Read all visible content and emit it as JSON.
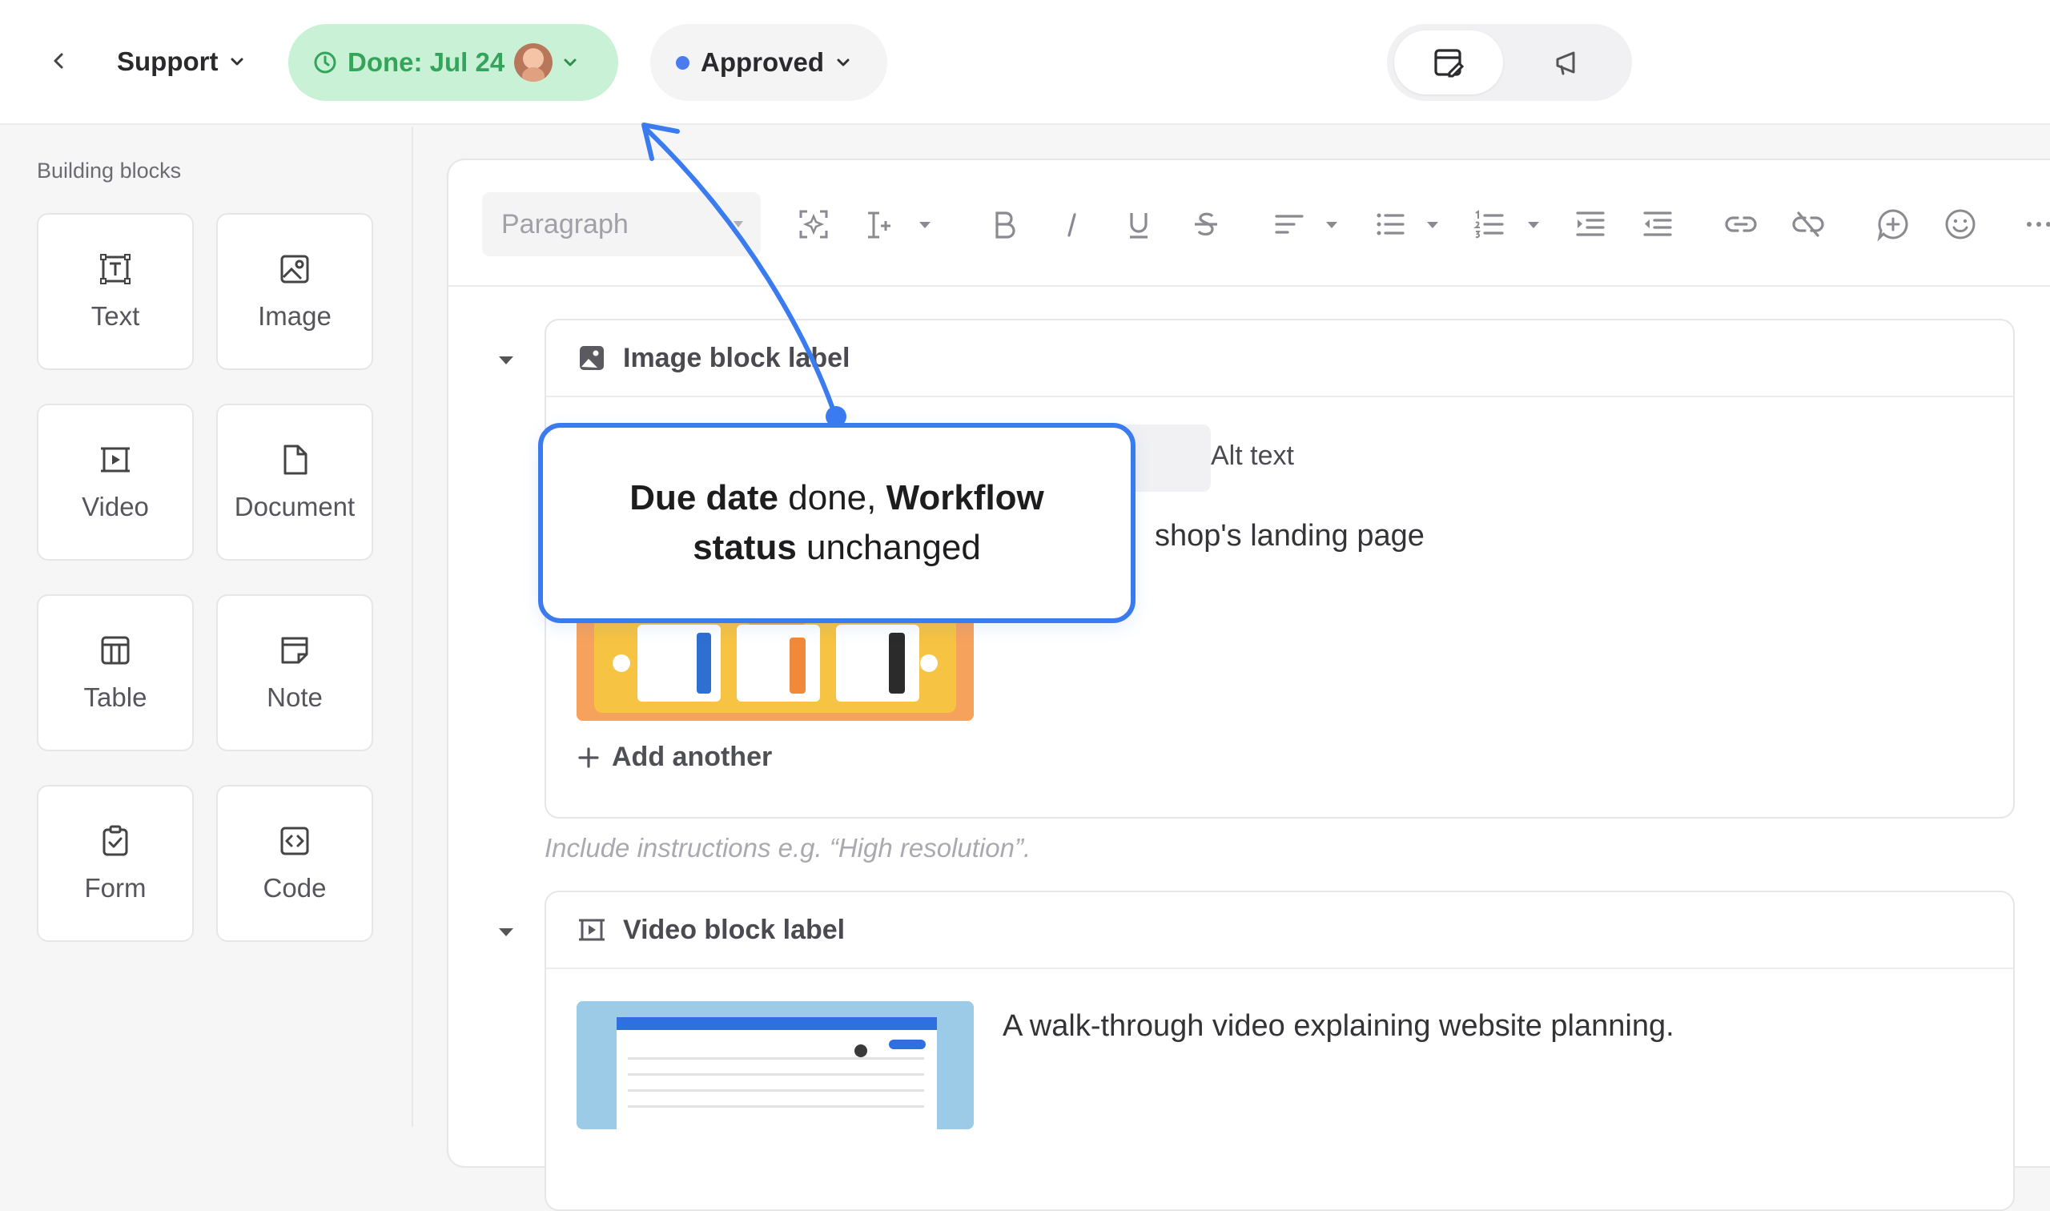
{
  "topbar": {
    "back_icon": "chevron-left-icon",
    "crumb_label": "Support",
    "due_label": "Done: Jul 24",
    "status_label": "Approved",
    "status_color": "#4a7cf0",
    "due_color": "#33a45a"
  },
  "sidebar": {
    "title": "Building blocks",
    "blocks": [
      {
        "label": "Text",
        "icon": "text-icon"
      },
      {
        "label": "Image",
        "icon": "image-icon"
      },
      {
        "label": "Video",
        "icon": "video-icon"
      },
      {
        "label": "Document",
        "icon": "document-icon"
      },
      {
        "label": "Table",
        "icon": "table-icon"
      },
      {
        "label": "Note",
        "icon": "note-icon"
      },
      {
        "label": "Form",
        "icon": "form-icon"
      },
      {
        "label": "Code",
        "icon": "code-icon"
      }
    ]
  },
  "editor": {
    "paragraph_select": "Paragraph",
    "image_block": {
      "label": "Image block label",
      "tab_alt": "Alt text",
      "caption": "shop's landing page",
      "add_another": "Add another"
    },
    "hint": "Include instructions e.g. “High resolution”.",
    "video_block": {
      "label": "Video block label",
      "description": "A walk-through video explaining website planning."
    }
  },
  "callout": {
    "part1_bold": "Due date",
    "part1": " done, ",
    "part2_bold": "Workflow status",
    "part2": " unchanged",
    "accent": "#3b7bf0"
  }
}
